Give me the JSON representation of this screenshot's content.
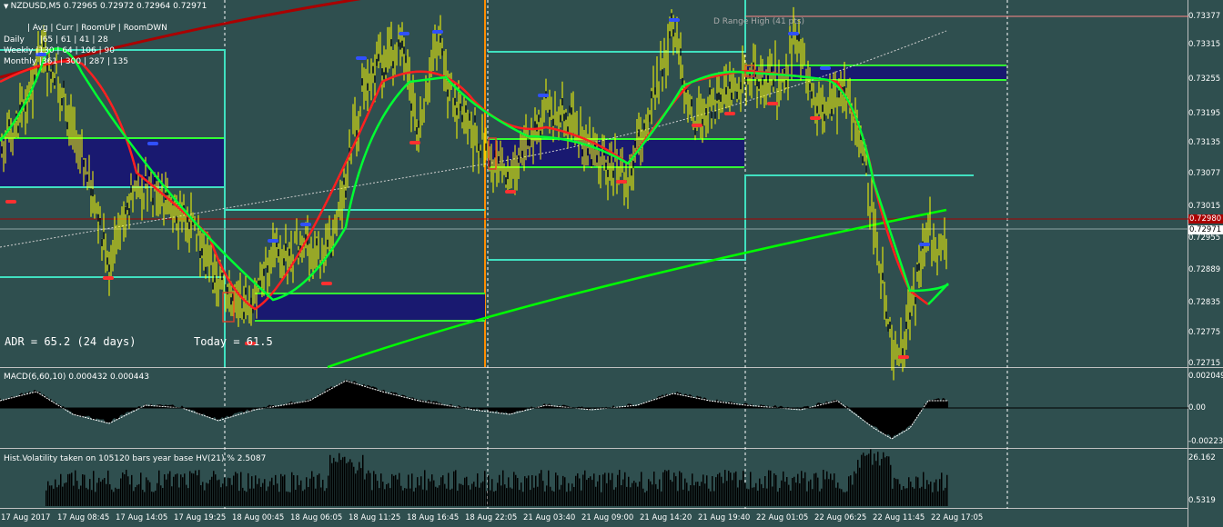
{
  "symbol_header": "NZDUSD,M5  0.72965 0.72972 0.72964 0.72971",
  "info_table": {
    "header": "|  Avg  | Curr  | RoomUP  | RoomDWN",
    "rows": [
      {
        "label": "Daily",
        "values": "|65 | 61 | 41 | 28"
      },
      {
        "label": "Weekly",
        "values": "|130 | 64 | 106 | 90"
      },
      {
        "label": "Monthly",
        "values": "|361 | 300 | 287 | 135"
      }
    ]
  },
  "adr_text": "ADR = 65.2  (24 days)",
  "today_text": "Today = 61.5",
  "range_label": "D Range High (41 pts)",
  "price_axis": [
    "0.73377",
    "0.73315",
    "0.73255",
    "0.73195",
    "0.73135",
    "0.73077",
    "0.73015",
    "0.72955",
    "0.72889",
    "0.72835",
    "0.72775",
    "0.72715"
  ],
  "price_tags": {
    "red_line": "0.72980",
    "current": "0.72971"
  },
  "macd": {
    "title": "MACD(6,60,10) 0.000432 0.000443",
    "axis": [
      "0.002049",
      "0.00",
      "-0.00223"
    ]
  },
  "hv": {
    "title": "Hist.Volatility  taken on 105120 bars year base  HV(21) %  2.5087",
    "axis": [
      "26.162",
      "0.5319"
    ]
  },
  "time_labels": [
    "17 Aug 2017",
    "17 Aug 08:45",
    "17 Aug 14:05",
    "17 Aug 19:25",
    "18 Aug 00:45",
    "18 Aug 06:05",
    "18 Aug 11:25",
    "18 Aug 16:45",
    "18 Aug 22:05",
    "21 Aug 03:40",
    "21 Aug 09:00",
    "21 Aug 14:20",
    "21 Aug 19:40",
    "22 Aug 01:05",
    "22 Aug 06:25",
    "22 Aug 11:45",
    "22 Aug 17:05"
  ],
  "colors": {
    "background": "#2f4f4f",
    "candles": "#ffff00",
    "fast_ma": "#ff2020",
    "slow_ma": "#00ff00",
    "range_box": "#191970",
    "range_lines": "#40e0c0",
    "long_ma": "#aa0000"
  }
}
